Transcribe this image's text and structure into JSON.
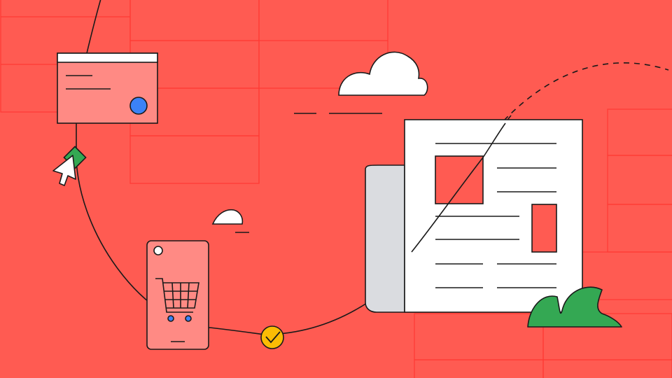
{
  "illustration": {
    "colors": {
      "background": "#ff5b52",
      "grid_line": "#ff3a34",
      "card_fill": "#ff8a84",
      "stroke": "#1a1a1a",
      "white": "#ffffff",
      "blue_dot": "#3b82f6",
      "green": "#34a853",
      "yellow": "#fbbc04",
      "newspaper_fold": "#dadce0"
    },
    "icons": [
      "browser-window-icon",
      "cursor-arrow-icon",
      "green-diamond-icon",
      "smartphone-icon",
      "shopping-cart-icon",
      "checkmark-badge-icon",
      "newspaper-icon",
      "cloud-icon",
      "leaf-plant-icon"
    ]
  }
}
